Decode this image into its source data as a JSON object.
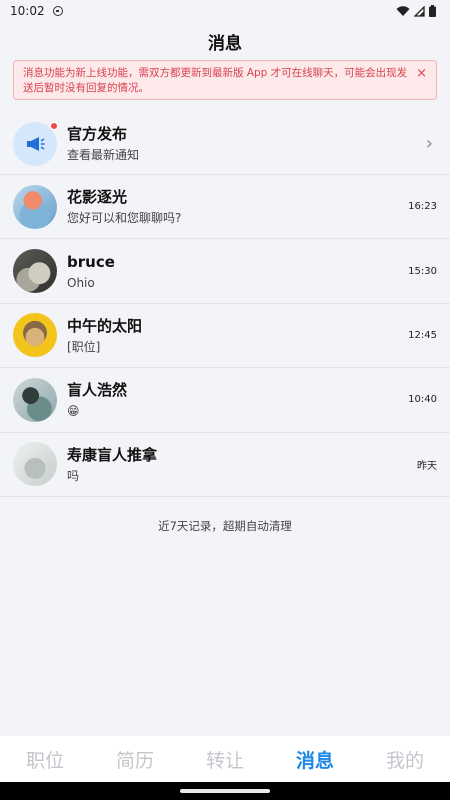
{
  "status_bar": {
    "time": "10:02"
  },
  "header": {
    "title": "消息"
  },
  "notice": {
    "text": "消息功能为新上线功能，需双方都更新到最新版 App 才可在线聊天，可能会出现发送后暂时没有回复的情况。",
    "close": "×"
  },
  "official": {
    "title": "官方发布",
    "subtitle": "查看最新通知",
    "chevron": "›"
  },
  "conversations": [
    {
      "name": "花影逐光",
      "message": "您好可以和您聊聊吗?",
      "time": "16:23"
    },
    {
      "name": "bruce",
      "message": "Ohio",
      "time": "15:30"
    },
    {
      "name": "中午的太阳",
      "message": "[职位]",
      "time": "12:45"
    },
    {
      "name": "盲人浩然",
      "message": "😁",
      "time": "10:40"
    },
    {
      "name": "寿康盲人推拿",
      "message": "吗",
      "time": "昨天"
    }
  ],
  "footer_note": "近7天记录，超期自动清理",
  "tabs": [
    {
      "label": "职位"
    },
    {
      "label": "简历"
    },
    {
      "label": "转让"
    },
    {
      "label": "消息"
    },
    {
      "label": "我的"
    }
  ],
  "colors": {
    "accent": "#1e88e5",
    "notice_red": "#d9414d",
    "unread_dot": "#f04848"
  }
}
